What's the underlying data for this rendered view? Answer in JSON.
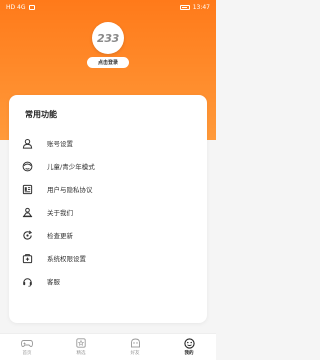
{
  "statusbar": {
    "left_text": "HD  4G",
    "right_text": "13:47"
  },
  "profile": {
    "avatar_text": "233",
    "login_label": "点击登录"
  },
  "menu": {
    "title": "常用功能",
    "items": [
      {
        "label": "账号设置",
        "icon": "user-icon"
      },
      {
        "label": "儿童/青少年模式",
        "icon": "child-face-icon"
      },
      {
        "label": "用户与隐私协议",
        "icon": "document-icon"
      },
      {
        "label": "关于我们",
        "icon": "info-person-icon"
      },
      {
        "label": "检查更新",
        "icon": "refresh-icon"
      },
      {
        "label": "系统权限设置",
        "icon": "permissions-icon"
      },
      {
        "label": "客服",
        "icon": "headset-icon"
      }
    ]
  },
  "tabbar": {
    "items": [
      {
        "label": "首页",
        "icon": "gamepad-icon",
        "active": false
      },
      {
        "label": "精选",
        "icon": "star-box-icon",
        "active": false
      },
      {
        "label": "好友",
        "icon": "friends-icon",
        "active": false
      },
      {
        "label": "我的",
        "icon": "smile-icon",
        "active": true
      }
    ]
  },
  "colors": {
    "accent": "#ff7a1a",
    "accent_light": "#ff9a3a"
  }
}
